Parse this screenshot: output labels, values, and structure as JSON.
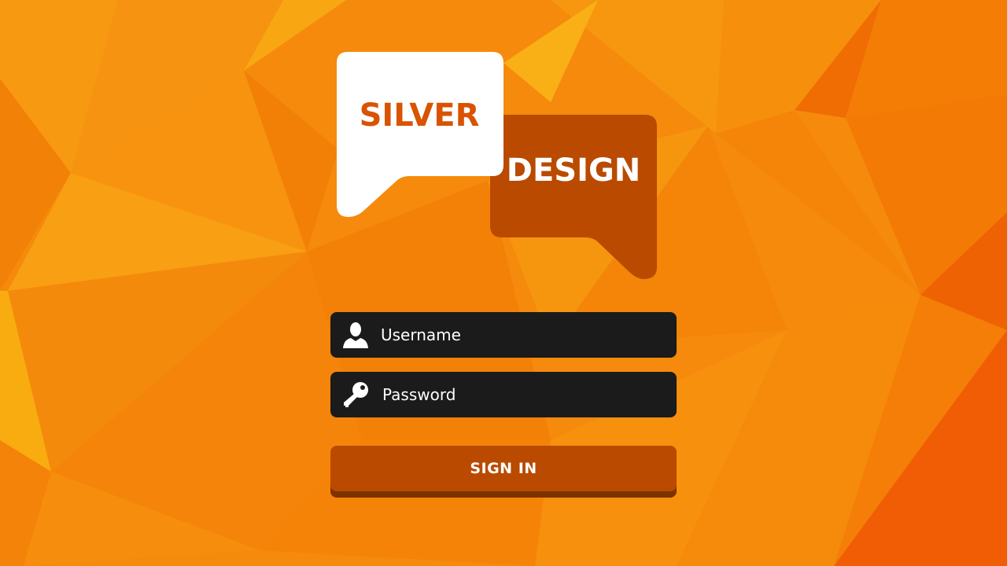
{
  "logo": {
    "word1": "SILVER",
    "word2": "DESIGN"
  },
  "username": {
    "placeholder": "Username",
    "icon": "user-icon"
  },
  "password": {
    "placeholder": "Password",
    "icon": "key-icon"
  },
  "signin": {
    "label": "SIGN IN"
  },
  "colors": {
    "background": "#f5880a",
    "accent": "#b94a00",
    "field": "#1b1b1b",
    "text": "#ffffff"
  }
}
